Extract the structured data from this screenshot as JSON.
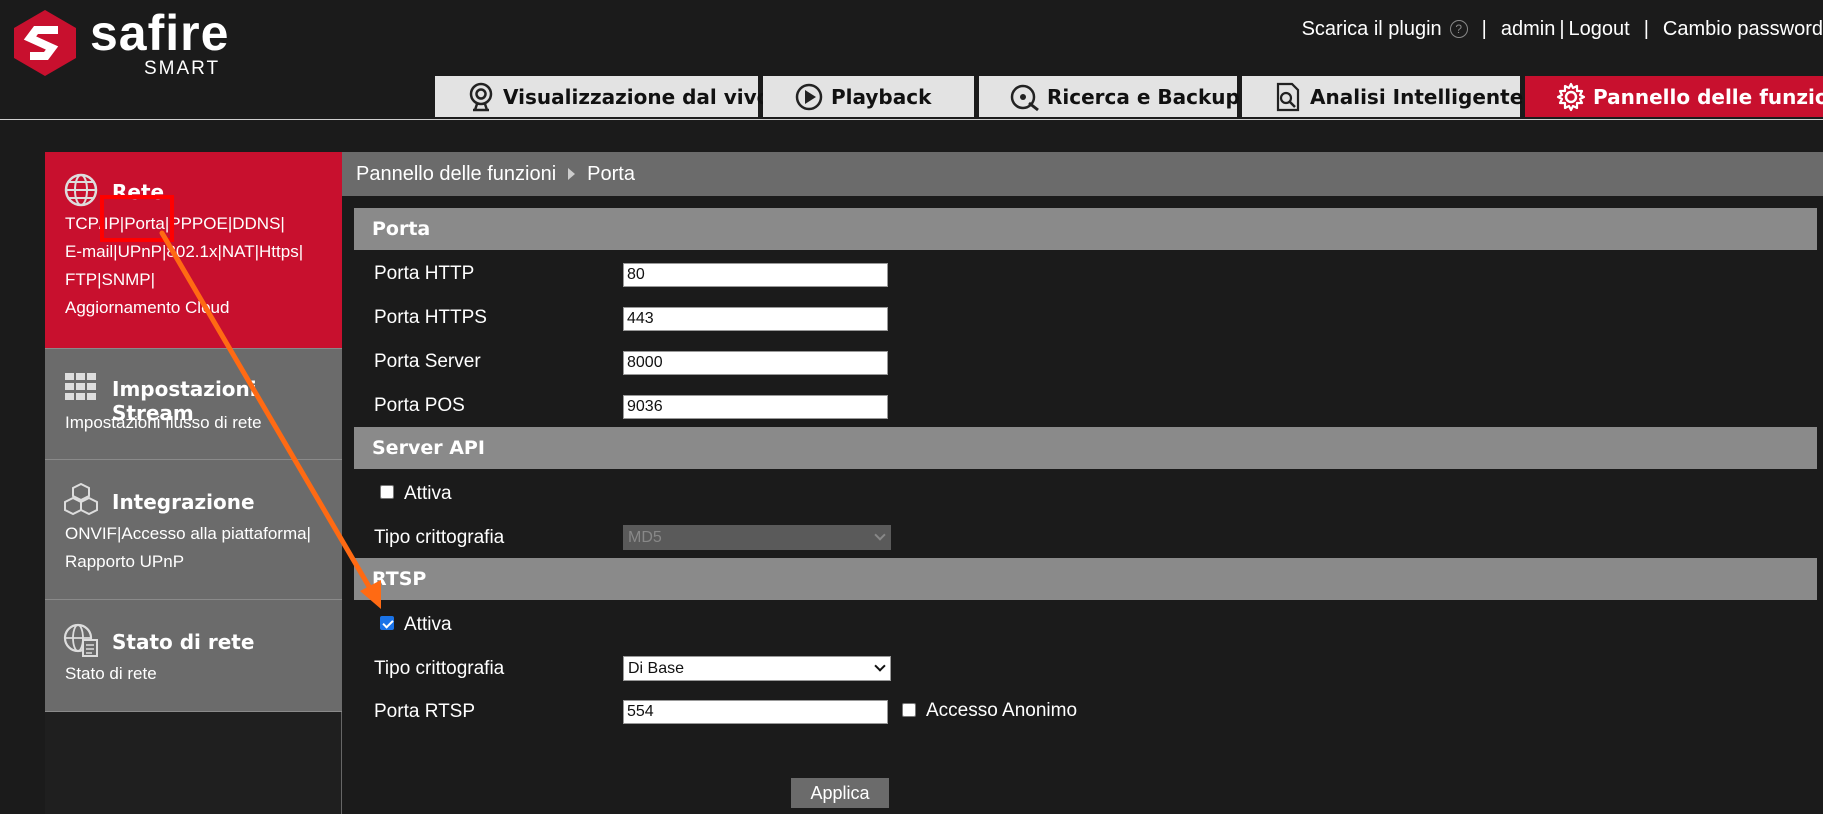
{
  "brand": {
    "name": "safire",
    "sub": "SMART"
  },
  "top_links": {
    "plugin": "Scarica il plugin",
    "user": "admin",
    "logout": "Logout",
    "change_password": "Cambio password",
    "sep1": "|",
    "sep2": "|",
    "sep3": "|"
  },
  "nav": [
    {
      "label": "Visualizzazione dal vivo",
      "icon": "webcam-icon"
    },
    {
      "label": "Playback",
      "icon": "play-circle-icon"
    },
    {
      "label": "Ricerca e Backup",
      "icon": "disc-search-icon"
    },
    {
      "label": "Analisi Intelligente",
      "icon": "document-search-icon"
    },
    {
      "label": "Pannello delle funzioni",
      "icon": "gear-icon",
      "active": true
    }
  ],
  "sidebar": [
    {
      "title": "Rete",
      "icon": "globe-icon",
      "links": "TCP/IP|Porta|PPPOE|DDNS|\nE-mail|UPnP|802.1x|NAT|Https|\nFTP|SNMP|\nAggiornamento Cloud",
      "active": true
    },
    {
      "title": "Impostazioni Stream",
      "icon": "grid-icon",
      "links": "Impostazioni flusso di rete"
    },
    {
      "title": "Integrazione",
      "icon": "cubes-icon",
      "links": "ONVIF|Accesso alla piattaforma|\nRapporto UPnP"
    },
    {
      "title": "Stato di rete",
      "icon": "globe-document-icon",
      "links": "Stato di rete"
    }
  ],
  "breadcrumb": {
    "root": "Pannello delle funzioni",
    "current": "Porta"
  },
  "sections": {
    "porta": {
      "title": "Porta",
      "http_label": "Porta HTTP",
      "http_value": "80",
      "https_label": "Porta HTTPS",
      "https_value": "443",
      "server_label": "Porta Server",
      "server_value": "8000",
      "pos_label": "Porta POS",
      "pos_value": "9036"
    },
    "server_api": {
      "title": "Server API",
      "enable_label": "Attiva",
      "enabled": false,
      "crypto_label": "Tipo crittografia",
      "crypto_value": "MD5"
    },
    "rtsp": {
      "title": "RTSP",
      "enable_label": "Attiva",
      "enabled": true,
      "crypto_label": "Tipo crittografia",
      "crypto_value": "Di Base",
      "port_label": "Porta RTSP",
      "port_value": "554",
      "anon_label": "Accesso Anonimo",
      "anonymous": false
    }
  },
  "apply_label": "Applica",
  "colors": {
    "accent": "#c8102e",
    "annotation": "#ff6a13",
    "highlight_box": "#ff0000",
    "panel_gray": "#6b6b6b",
    "section_gray": "#8a8a8a"
  }
}
